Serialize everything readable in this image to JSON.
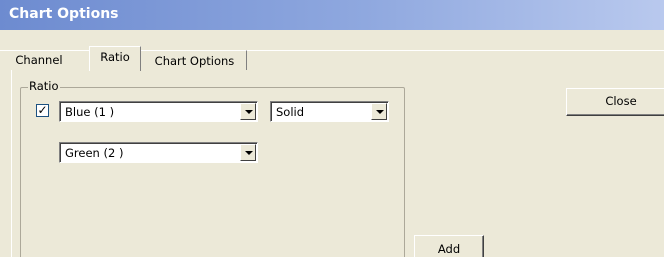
{
  "window": {
    "title": "Chart Options"
  },
  "tabs": [
    {
      "label": "Channel"
    },
    {
      "label": "Ratio"
    },
    {
      "label": "Chart Options"
    }
  ],
  "ratio_group": {
    "label": "Ratio",
    "checkbox_checked": true,
    "checkbox_mark": "✓",
    "row1": {
      "channel_value": "Blue (1 )",
      "style_value": "Solid"
    },
    "row2": {
      "channel_value": "Green (2 )"
    }
  },
  "buttons": {
    "close": "Close",
    "add": "Add"
  }
}
